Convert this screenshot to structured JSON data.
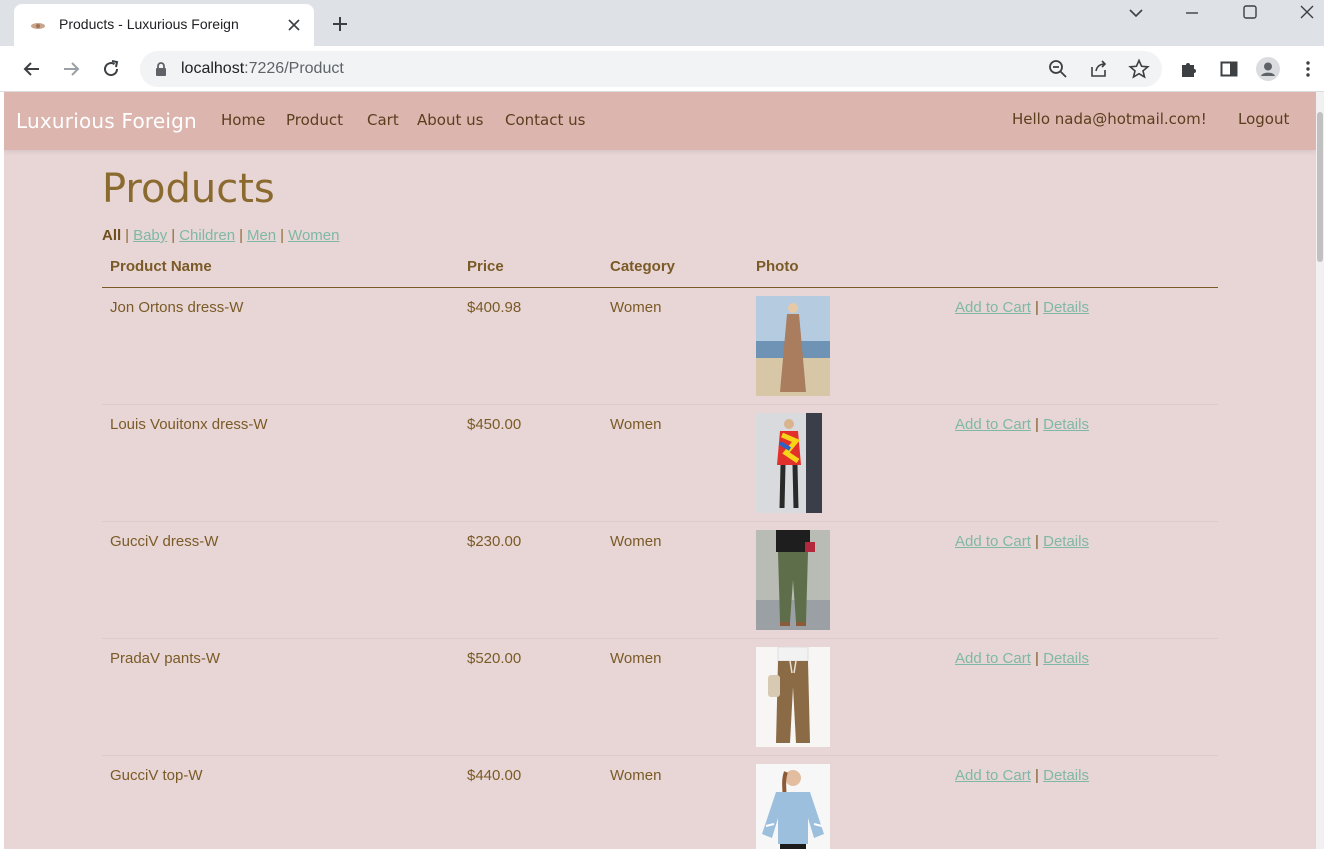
{
  "browser": {
    "tab_title": "Products - Luxurious Foreign",
    "url_host": "localhost",
    "url_rest": ":7226/Product"
  },
  "navbar": {
    "brand": "Luxurious Foreign",
    "links": [
      "Home",
      "Product",
      "Cart",
      "About us",
      "Contact us"
    ],
    "greeting": "Hello nada@hotmail.com!",
    "logout": "Logout"
  },
  "main": {
    "heading": "Products",
    "filters": {
      "active": "All",
      "links": [
        "Baby",
        "Children",
        "Men",
        "Women"
      ],
      "separator": "|"
    },
    "table": {
      "headers": [
        "Product Name",
        "Price",
        "Category",
        "Photo"
      ],
      "add_label": "Add to Cart",
      "details_label": "Details",
      "action_separator": "|",
      "rows": [
        {
          "name": "Jon Ortons dress-W",
          "price": "$400.98",
          "category": "Women",
          "photo": "photo-sand-dress"
        },
        {
          "name": "Louis Vouitonx dress-W",
          "price": "$450.00",
          "category": "Women",
          "photo": "photo-print-dress"
        },
        {
          "name": "GucciV dress-W",
          "price": "$230.00",
          "category": "Women",
          "photo": "photo-green-pants"
        },
        {
          "name": "PradaV pants-W",
          "price": "$520.00",
          "category": "Women",
          "photo": "photo-brown-pants"
        },
        {
          "name": "GucciV top-W",
          "price": "$440.00",
          "category": "Women",
          "photo": "photo-blue-top"
        }
      ]
    }
  },
  "colors": {
    "page_bg": "#e8d6d6",
    "navbar_bg": "#dbb5ae",
    "heading": "#8b6a2f",
    "link": "#7fb8a6"
  }
}
